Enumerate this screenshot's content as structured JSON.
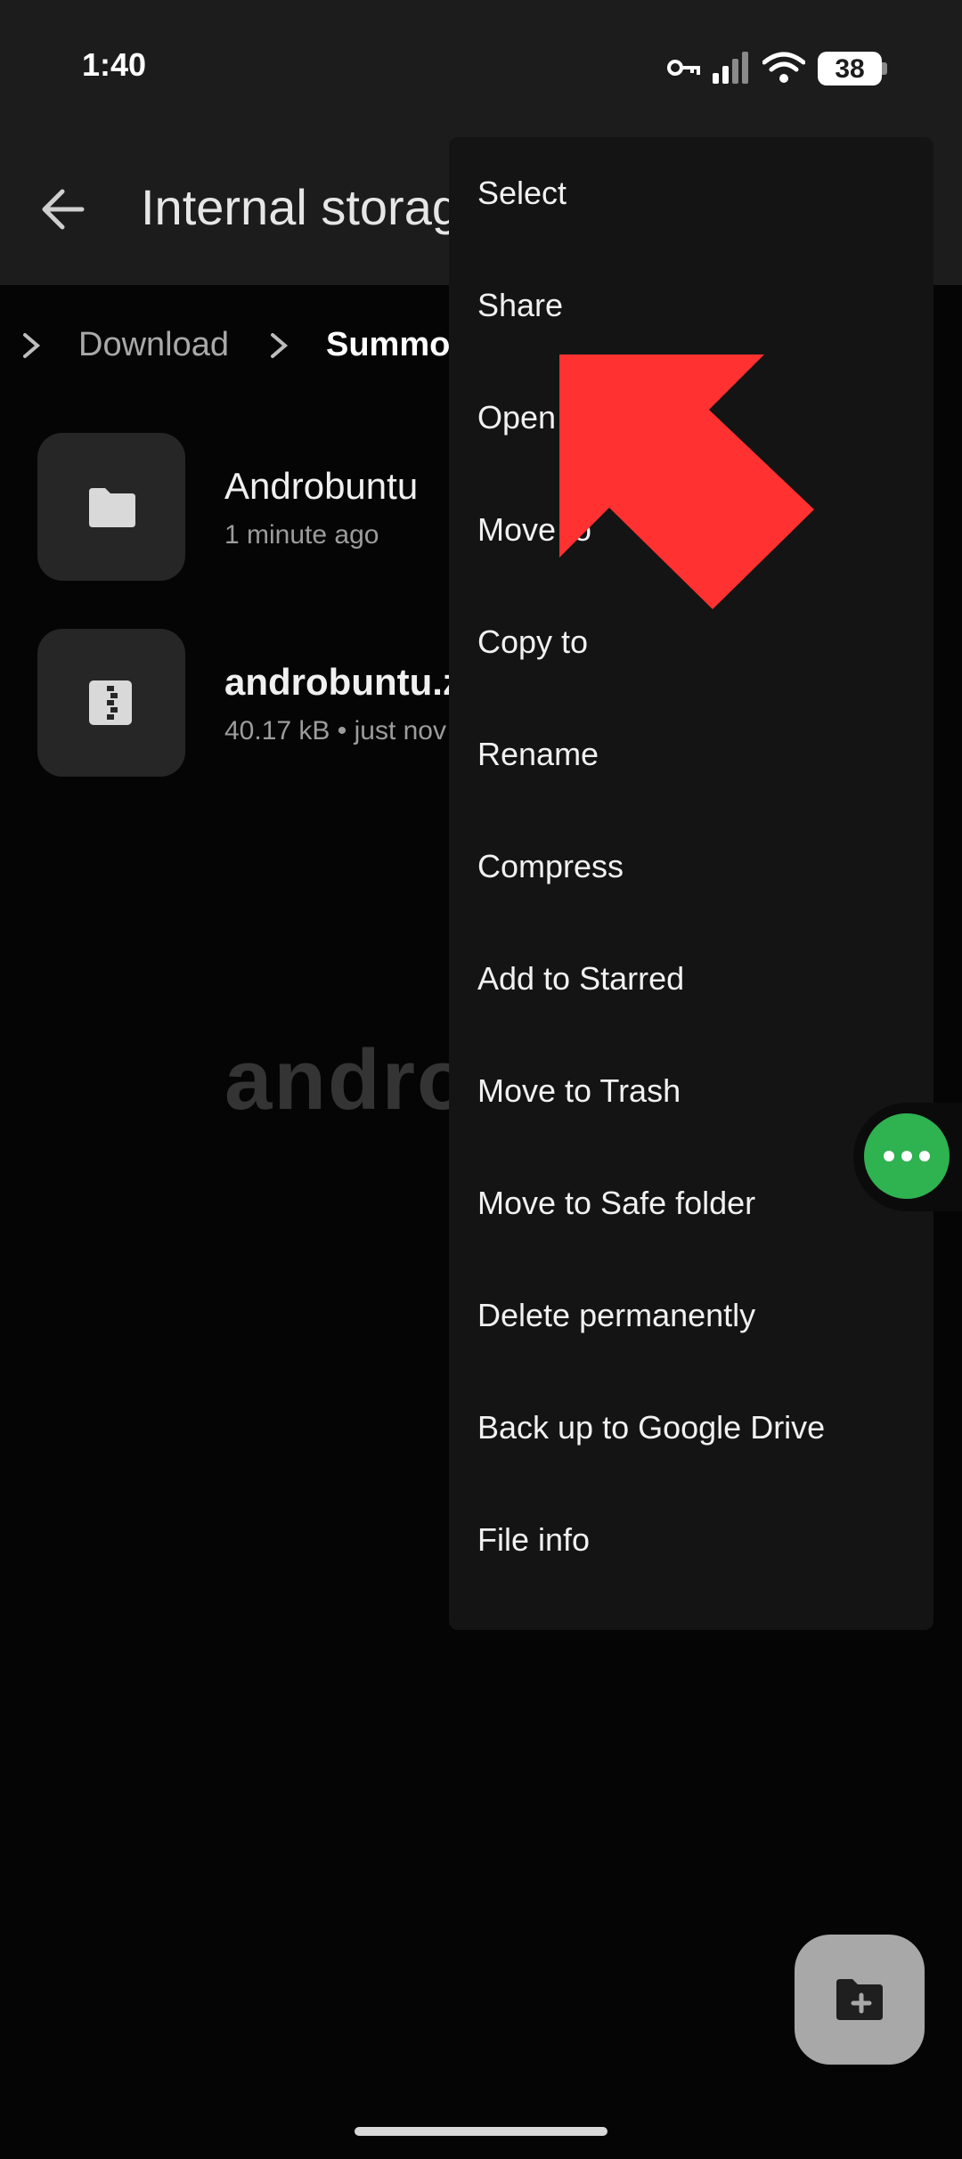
{
  "status_bar": {
    "time": "1:40",
    "battery": "38",
    "icons": [
      "vpn-key-icon",
      "signal-icon",
      "wifi-icon",
      "battery-icon"
    ]
  },
  "app_bar": {
    "title": "Internal storag",
    "back_icon": "arrow-left-icon"
  },
  "breadcrumb": {
    "items": [
      "Download",
      "Summon"
    ]
  },
  "files": [
    {
      "name": "Androbuntu",
      "meta": "1 minute ago",
      "icon": "folder-icon"
    },
    {
      "name": "androbuntu.z",
      "meta": "40.17 kB • just nov",
      "icon": "zip-file-icon"
    }
  ],
  "context_menu": {
    "items": [
      "Select",
      "Share",
      "Open",
      "Move to",
      "Copy to",
      "Rename",
      "Compress",
      "Add to Starred",
      "Move to Trash",
      "Move to Safe folder",
      "Delete permanently",
      "Back up to Google Drive",
      "File info"
    ]
  },
  "watermark": "androbuntu",
  "floating_bubble": {
    "icon": "more-horiz-icon",
    "color": "#2fb250"
  },
  "fab": {
    "icon": "new-folder-icon"
  },
  "colors": {
    "background": "#050505",
    "app_bar": "#1c1c1c",
    "menu": "#141414",
    "arrow": "#ff3131"
  }
}
